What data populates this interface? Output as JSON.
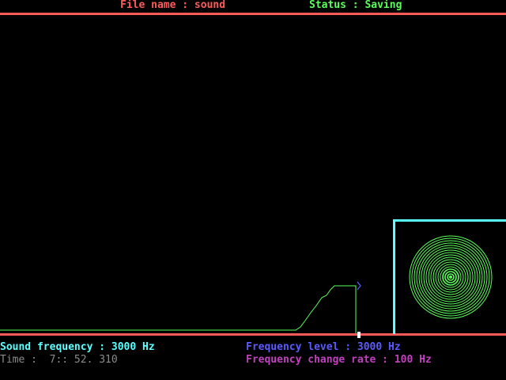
{
  "header": {
    "file_name": "File name : sound",
    "status": "Status : Saving"
  },
  "footer": {
    "sound_frequency": "Sound frequency : 3000 Hz",
    "time": "Time :  7:: 52. 310",
    "frequency_level": "Frequency level : 3000 Hz",
    "frequency_change_rate": "Frequency change rate : 100 Hz"
  },
  "colors": {
    "background": "#000000",
    "rule": "#ff5a5a",
    "file_name": "#ff5a5a",
    "status": "#5aff5a",
    "sound_frequency": "#5affff",
    "time": "#8c8c8c",
    "frequency_level": "#5a5aff",
    "frequency_change_rate": "#c040c0",
    "waveform": "#5aff5a",
    "marker": "#5a5aff",
    "speaker_frame": "#5affff",
    "speaker_rings": "#5aff5a"
  },
  "waveform_trace": {
    "baseline_level": 0,
    "peak_level": 1
  },
  "speaker": {
    "icon": "speaker-cone-icon"
  }
}
